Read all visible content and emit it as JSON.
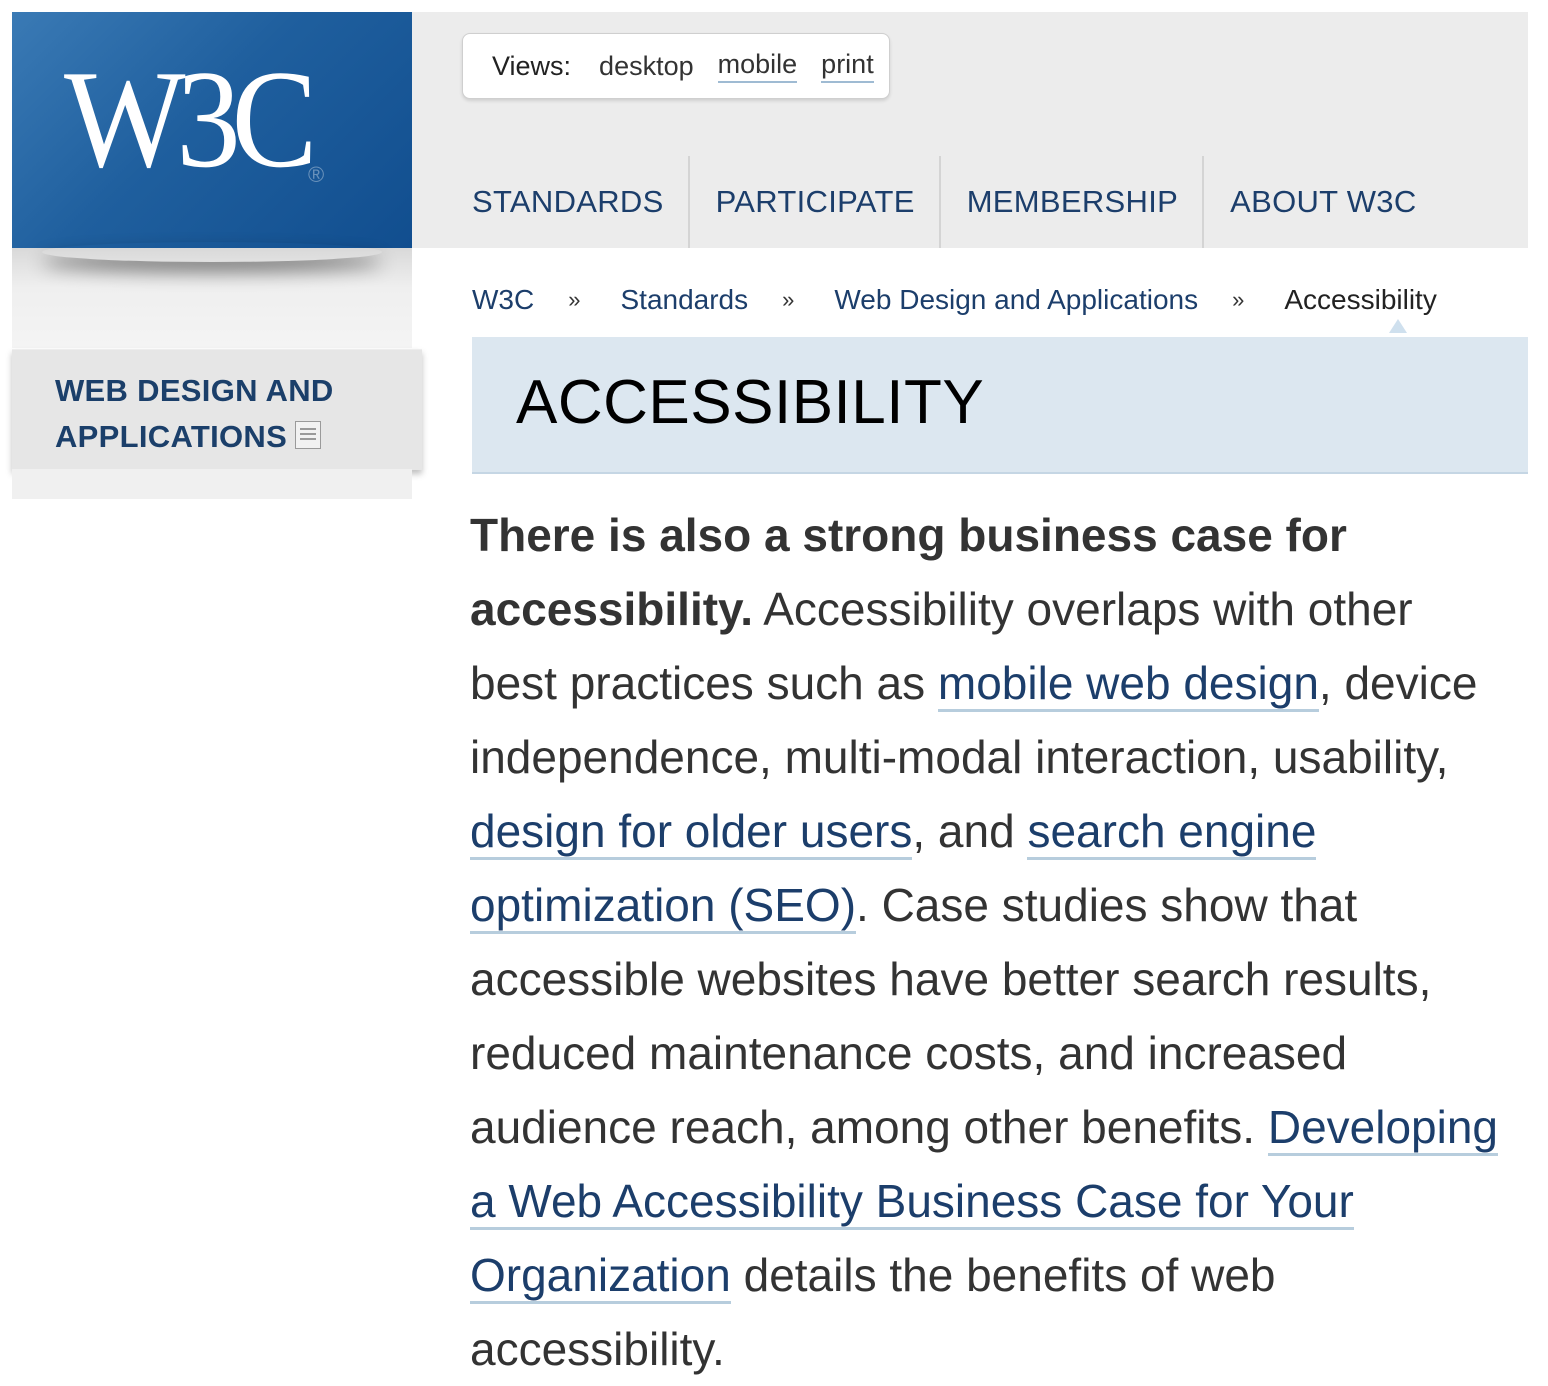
{
  "logo": {
    "text": "W3C",
    "registered": "®"
  },
  "views": {
    "label": "Views:",
    "options": [
      "desktop",
      "mobile",
      "print"
    ]
  },
  "nav": {
    "items": [
      "STANDARDS",
      "PARTICIPATE",
      "MEMBERSHIP",
      "ABOUT W3C"
    ]
  },
  "breadcrumb": {
    "items": [
      "W3C",
      "Standards",
      "Web Design and Applications",
      "Accessibility"
    ],
    "separator": "»"
  },
  "page": {
    "title": "ACCESSIBILITY"
  },
  "sidebar": {
    "heading_line1": "WEB DESIGN AND",
    "heading_line2": "APPLICATIONS"
  },
  "content": {
    "lead_bold": "There is also a strong business case for accessibility.",
    "t1": " Accessibility overlaps with other best practices such as ",
    "link1": "mobile web design",
    "t2": ", device independence, multi-modal interaction, usability, ",
    "link2": "design for older users",
    "t3": ", and ",
    "link3": "search engine optimization (SEO)",
    "t4": ". Case studies show that accessible websites have better search results, reduced maintenance costs, and increased audience reach, among other benefits. ",
    "link4": "Developing a Web Accessibility Business Case for Your Organization",
    "t5": " details the benefits of web accessibility."
  },
  "colors": {
    "brand_blue": "#1f5f9e",
    "link": "#1c3e6b",
    "title_band": "#dce7f0"
  }
}
